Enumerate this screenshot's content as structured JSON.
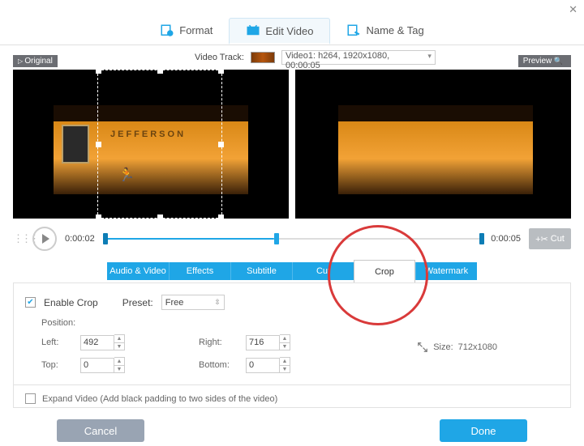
{
  "titlebar": {
    "close": "✕"
  },
  "top_tabs": {
    "format": "Format",
    "edit": "Edit Video",
    "name": "Name & Tag"
  },
  "track": {
    "label": "Video Track:",
    "selected": "Video1: h264, 1920x1080, 00:00:05"
  },
  "labels": {
    "original": "Original",
    "preview": "Preview"
  },
  "timeline": {
    "current": "0:00:02",
    "total": "0:00:05",
    "cut": "Cut"
  },
  "sub_tabs": {
    "av": "Audio & Video",
    "effects": "Effects",
    "subtitle": "Subtitle",
    "cut": "Cut",
    "crop": "Crop",
    "watermark": "Watermark"
  },
  "crop": {
    "enable": "Enable Crop",
    "preset_label": "Preset:",
    "preset_value": "Free",
    "position": "Position:",
    "left_label": "Left:",
    "left": "492",
    "right_label": "Right:",
    "right": "716",
    "top_label": "Top:",
    "top": "0",
    "bottom_label": "Bottom:",
    "bottom": "0",
    "size_label": "Size:",
    "size_value": "712x1080",
    "expand": "Expand Video (Add black padding to two sides of the video)"
  },
  "footer": {
    "cancel": "Cancel",
    "done": "Done"
  }
}
